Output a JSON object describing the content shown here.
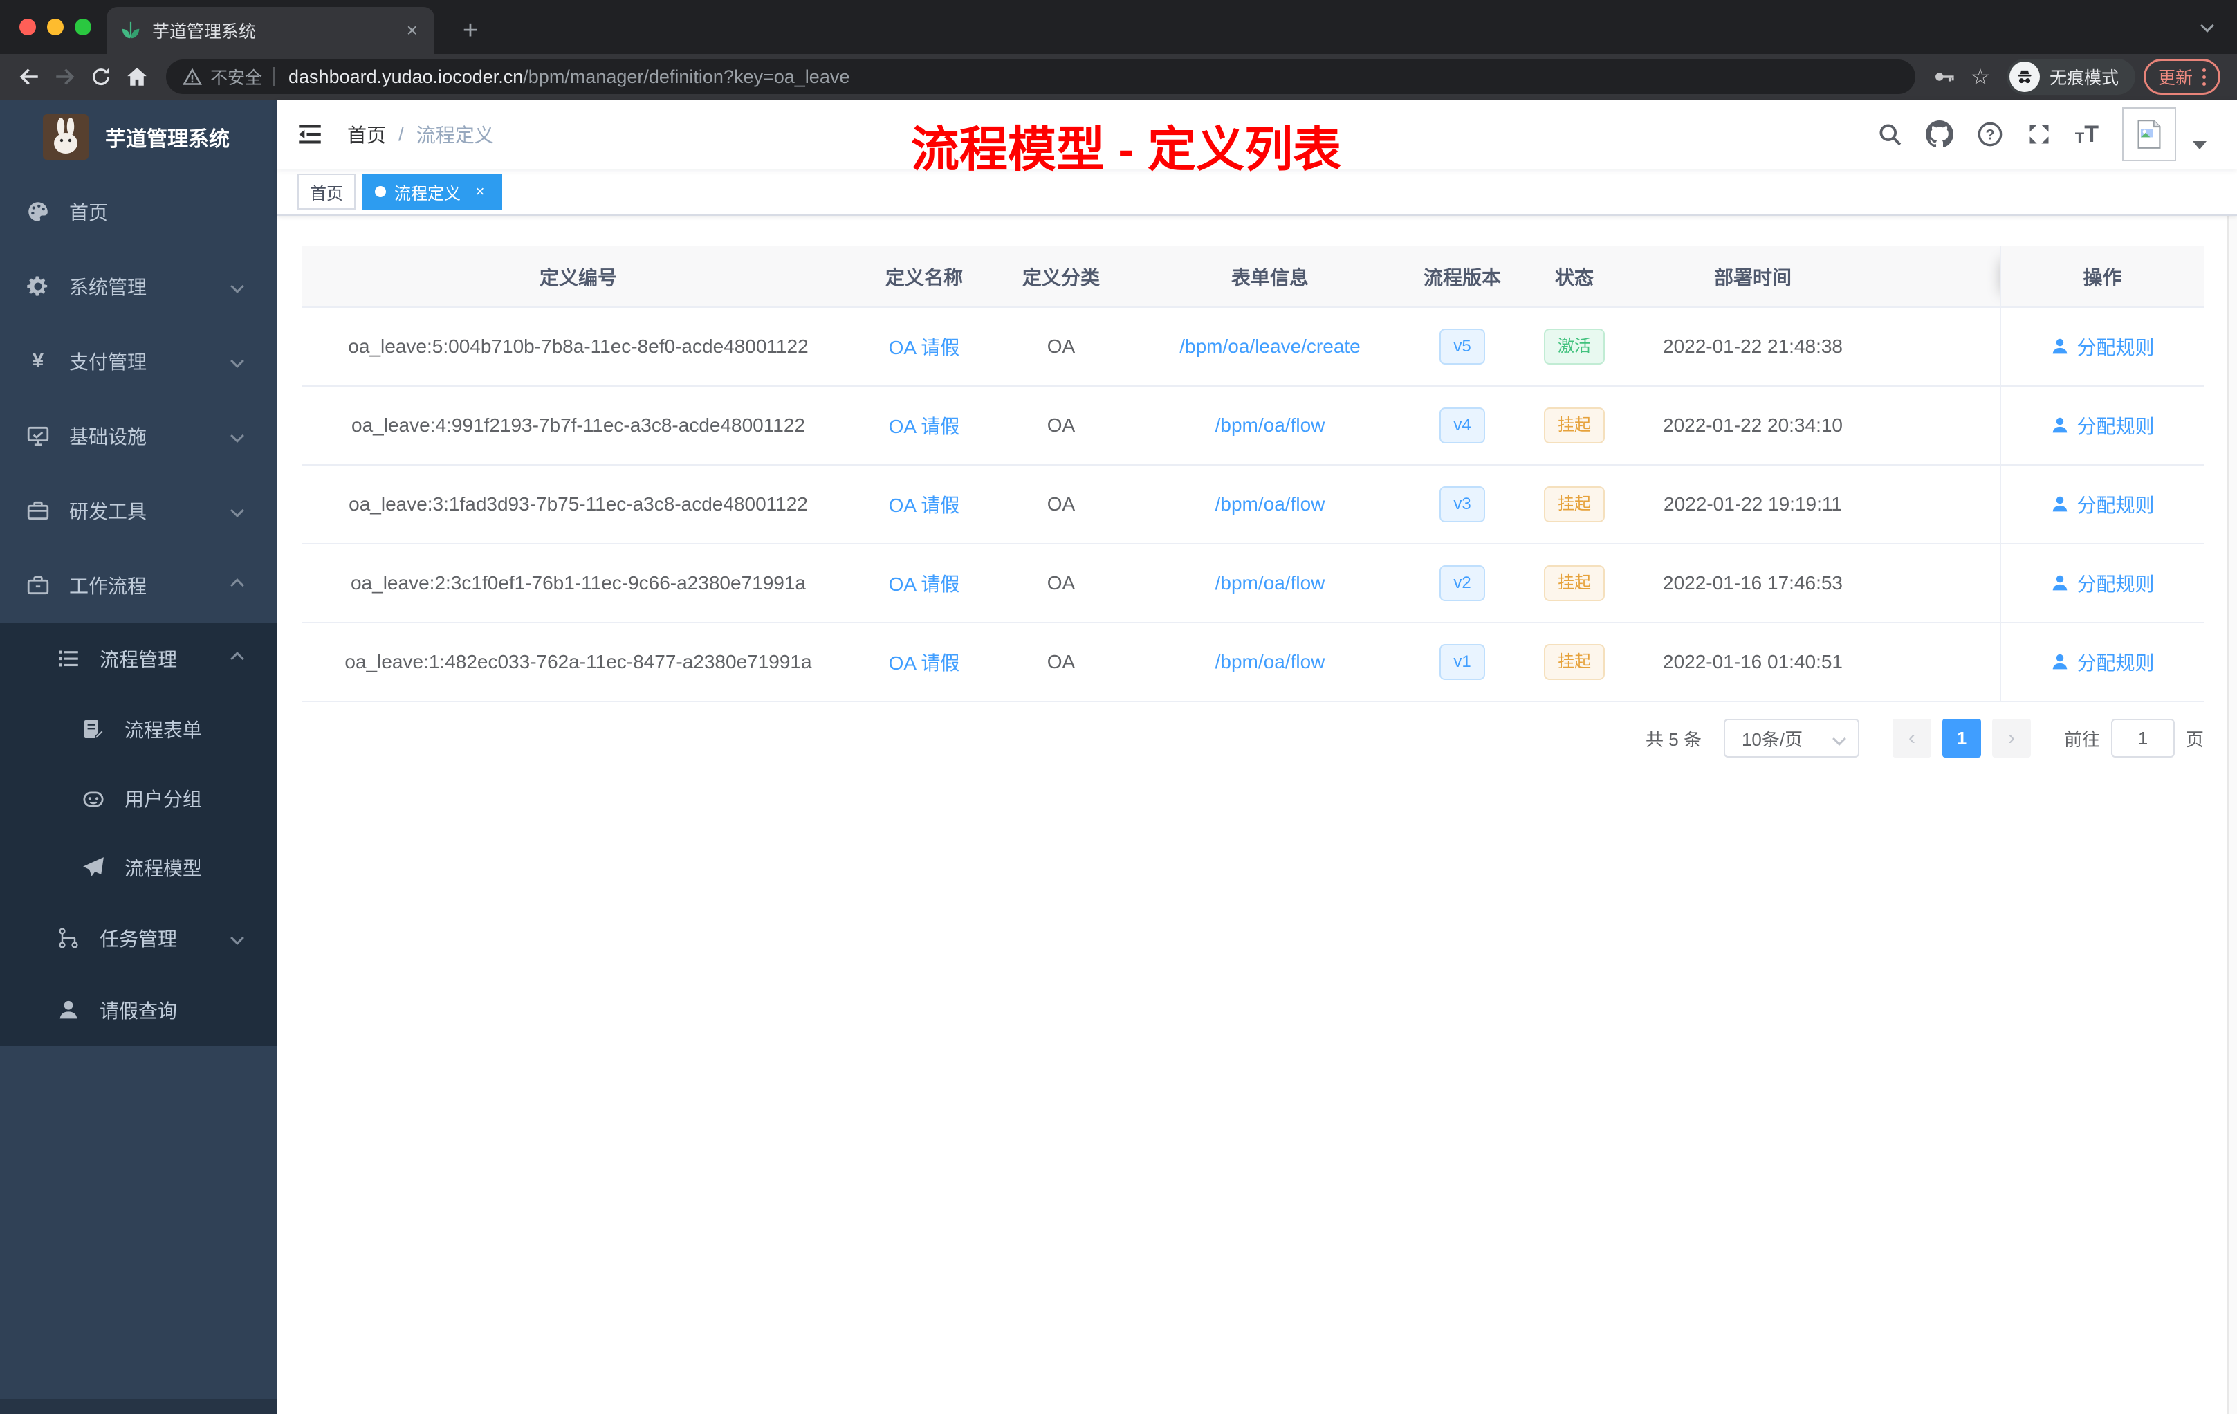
{
  "colors": {
    "accent": "#409eff",
    "annotation_red": "#fe0100",
    "sidebar_bg": "#304156",
    "sidebar_submenu_bg": "#1f2d3d",
    "active_tag_bg": "#2d9cf0",
    "status_active_green": "#42c27e",
    "status_suspend_orange": "#e6a23c",
    "update_button_red": "#ee8a80",
    "table_header_bg": "#f8f8f9"
  },
  "browser": {
    "tab": {
      "title": "芋道管理系统",
      "close_glyph": "×",
      "new_tab_glyph": "+"
    },
    "toolbar": {
      "security_label": "不安全",
      "url_host": "dashboard.yudao.iocoder.cn",
      "url_path": "/bpm/manager/definition?key=oa_leave",
      "incognito_label": "无痕模式",
      "update_label": "更新"
    }
  },
  "annotation": {
    "title": "流程模型 - 定义列表"
  },
  "sidebar": {
    "logo_title": "芋道管理系统",
    "items": [
      {
        "label": "首页",
        "icon": "dashboard-icon",
        "level": 1,
        "chevron": null
      },
      {
        "label": "系统管理",
        "icon": "gear-icon",
        "level": 1,
        "chevron": "down"
      },
      {
        "label": "支付管理",
        "icon": "yen-icon",
        "level": 1,
        "chevron": "down"
      },
      {
        "label": "基础设施",
        "icon": "monitor-icon",
        "level": 1,
        "chevron": "down"
      },
      {
        "label": "研发工具",
        "icon": "toolbox-icon",
        "level": 1,
        "chevron": "down"
      },
      {
        "label": "工作流程",
        "icon": "briefcase-icon",
        "level": 1,
        "chevron": "up"
      },
      {
        "label": "流程管理",
        "icon": "list-icon",
        "level": 2,
        "chevron": "up"
      },
      {
        "label": "流程表单",
        "icon": "form-icon",
        "level": 3,
        "chevron": null
      },
      {
        "label": "用户分组",
        "icon": "robot-icon",
        "level": 3,
        "chevron": null
      },
      {
        "label": "流程模型",
        "icon": "paper-plane-icon",
        "level": 3,
        "chevron": null
      },
      {
        "label": "任务管理",
        "icon": "tree-icon",
        "level": 2,
        "chevron": "down"
      },
      {
        "label": "请假查询",
        "icon": "person-icon",
        "level": 2,
        "chevron": null
      }
    ]
  },
  "navbar": {
    "breadcrumb": {
      "home": "首页",
      "separator": "/",
      "current": "流程定义"
    },
    "icons": [
      "search-icon",
      "github-icon",
      "help-icon",
      "fullscreen-icon",
      "text-size-icon"
    ]
  },
  "tags": [
    {
      "label": "首页",
      "active": false
    },
    {
      "label": "流程定义",
      "active": true,
      "close_glyph": "×"
    }
  ],
  "table": {
    "columns": [
      "定义编号",
      "定义名称",
      "定义分类",
      "表单信息",
      "流程版本",
      "状态",
      "部署时间",
      "操作"
    ],
    "rows": [
      {
        "id": "oa_leave:5:004b710b-7b8a-11ec-8ef0-acde48001122",
        "name": "OA 请假",
        "category": "OA",
        "form": "/bpm/oa/leave/create",
        "version": "v5",
        "status": "激活",
        "deploy_time": "2022-01-22 21:48:38",
        "action": "分配规则"
      },
      {
        "id": "oa_leave:4:991f2193-7b7f-11ec-a3c8-acde48001122",
        "name": "OA 请假",
        "category": "OA",
        "form": "/bpm/oa/flow",
        "version": "v4",
        "status": "挂起",
        "deploy_time": "2022-01-22 20:34:10",
        "action": "分配规则"
      },
      {
        "id": "oa_leave:3:1fad3d93-7b75-11ec-a3c8-acde48001122",
        "name": "OA 请假",
        "category": "OA",
        "form": "/bpm/oa/flow",
        "version": "v3",
        "status": "挂起",
        "deploy_time": "2022-01-22 19:19:11",
        "action": "分配规则"
      },
      {
        "id": "oa_leave:2:3c1f0ef1-76b1-11ec-9c66-a2380e71991a",
        "name": "OA 请假",
        "category": "OA",
        "form": "/bpm/oa/flow",
        "version": "v2",
        "status": "挂起",
        "deploy_time": "2022-01-16 17:46:53",
        "action": "分配规则"
      },
      {
        "id": "oa_leave:1:482ec033-762a-11ec-8477-a2380e71991a",
        "name": "OA 请假",
        "category": "OA",
        "form": "/bpm/oa/flow",
        "version": "v1",
        "status": "挂起",
        "deploy_time": "2022-01-16 01:40:51",
        "action": "分配规则"
      }
    ]
  },
  "pagination": {
    "total": "共 5 条",
    "page_size": "10条/页",
    "prev_glyph": "‹",
    "current_page": "1",
    "next_glyph": "›",
    "goto_label": "前往",
    "goto_value": "1",
    "page_unit": "页"
  }
}
